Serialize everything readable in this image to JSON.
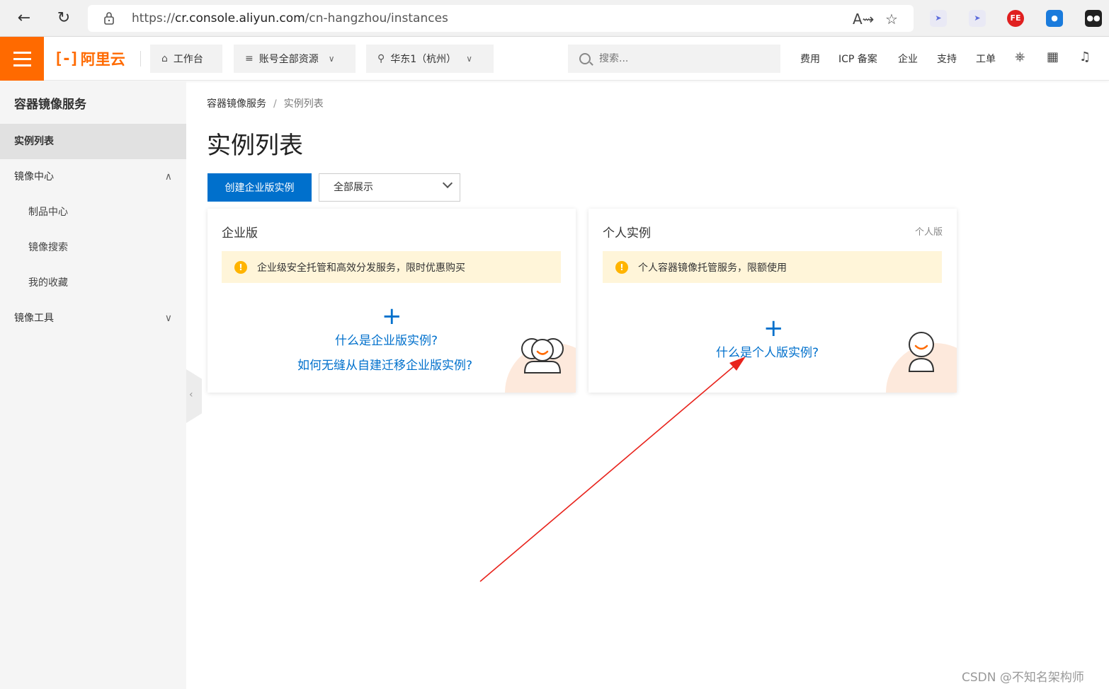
{
  "browser": {
    "url_prefix": "https://",
    "url_host": "cr.console.aliyun.com",
    "url_path": "/cn-hangzhou/instances"
  },
  "header": {
    "logo_text": "阿里云",
    "workbench": "工作台",
    "resources": "账号全部资源",
    "region": "华东1（杭州）",
    "search_placeholder": "搜索...",
    "links": [
      "费用",
      "ICP 备案",
      "企业",
      "支持",
      "工单"
    ]
  },
  "sidebar": {
    "title": "容器镜像服务",
    "items": [
      {
        "label": "实例列表"
      },
      {
        "label": "镜像中心"
      },
      {
        "label": "制品中心"
      },
      {
        "label": "镜像搜索"
      },
      {
        "label": "我的收藏"
      },
      {
        "label": "镜像工具"
      }
    ]
  },
  "main": {
    "breadcrumb": [
      "容器镜像服务",
      "实例列表"
    ],
    "breadcrumb_sep": "/",
    "title": "实例列表",
    "create_button": "创建企业版实例",
    "filter_value": "全部展示",
    "cards": [
      {
        "title": "企业版",
        "notice": "企业级安全托管和高效分发服务，限时优惠购买",
        "links": [
          "什么是企业版实例?",
          "如何无缝从自建迁移企业版实例?"
        ]
      },
      {
        "title": "个人实例",
        "tag": "个人版",
        "notice": "个人容器镜像托管服务，限额使用",
        "links": [
          "什么是个人版实例?"
        ]
      }
    ]
  },
  "watermark": "CSDN @不知名架构师",
  "colors": {
    "brand": "#ff6a00",
    "primary": "#0070cc",
    "notice_bg": "#fff5d9",
    "warn": "#ffb400",
    "annotation_arrow": "#e8231c"
  }
}
